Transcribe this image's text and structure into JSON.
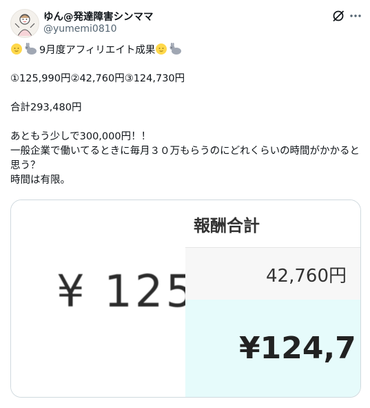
{
  "author": {
    "display_name": "ゆん@発達障害シンママ",
    "handle": "@yumemi0810"
  },
  "header_icons": {
    "grok": "grok-icon",
    "more": "more-icon"
  },
  "tweet": {
    "line1_text": "9月度アフィリエイト成果",
    "line1_icons": [
      "full-moon-face-emoji",
      "rabbit-emoji"
    ],
    "line2": "①125,990円②42,760円③124,730円",
    "line3": "合計293,480円",
    "line4": "あともう少しで300,000円！！",
    "line5": "一般企業で働いてるときに毎月３０万もらうのにどれくらいの時間がかかると思う？",
    "line6": "時間は有限。"
  },
  "media": {
    "left_text": "¥ 125",
    "right_header": "報酬合計",
    "right_mid_value": "42,760円",
    "right_bottom_value": "¥124,7"
  },
  "colors": {
    "text": "#0f1419",
    "secondary": "#536471",
    "card_border": "#cfd9de",
    "highlight_bg": "#e6fbfb"
  }
}
